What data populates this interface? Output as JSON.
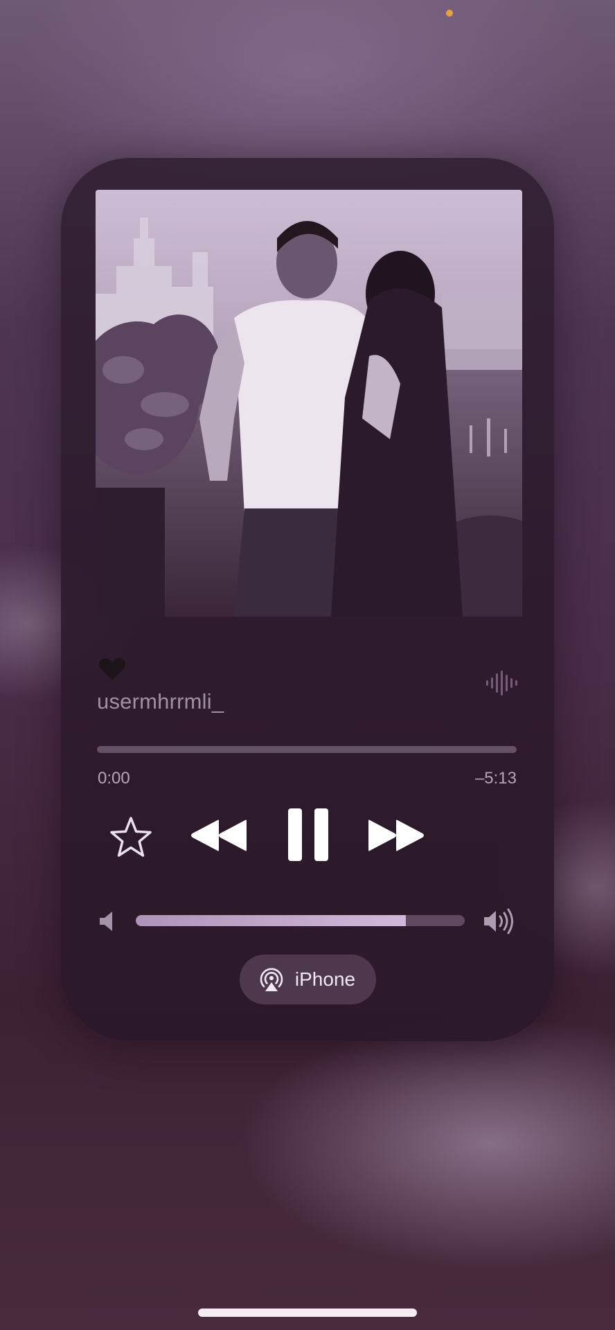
{
  "now_playing": {
    "emoji": "🖤",
    "title": "usermhrrmli_",
    "progress": 0.0,
    "elapsed": "0:00",
    "remaining": "–5:13"
  },
  "controls": {
    "favorite_icon": "star-outline-icon",
    "rewind_icon": "rewind-icon",
    "playpause_icon": "pause-icon",
    "forward_icon": "fast-forward-icon"
  },
  "volume": {
    "level": 0.82,
    "min_icon": "speaker-min-icon",
    "max_icon": "speaker-max-icon"
  },
  "output": {
    "icon": "airplay-icon",
    "label": "iPhone"
  },
  "colors": {
    "accent": "#e9a23b",
    "text": "#f1e9f2"
  }
}
